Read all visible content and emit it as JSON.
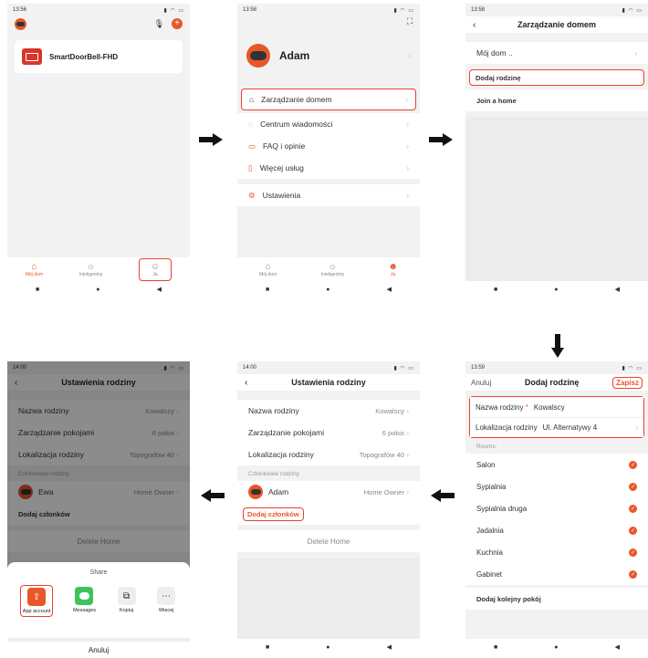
{
  "screen1": {
    "time": "13:56",
    "device_name": "SmartDoorBell-FHD",
    "tabs": [
      {
        "label": "Mój dom",
        "icon": "home-icon"
      },
      {
        "label": "Inteligentny",
        "icon": "sun-icon"
      },
      {
        "label": "Ja",
        "icon": "user-icon"
      }
    ]
  },
  "screen2": {
    "time": "13:58",
    "user_name": "Adam",
    "menu": [
      {
        "label": "Zarządzanie domem",
        "icon": "house-outline-icon"
      },
      {
        "label": "Centrum wiadomości",
        "icon": "chat-icon"
      },
      {
        "label": "FAQ i opinie",
        "icon": "faq-icon"
      },
      {
        "label": "Więcej usług",
        "icon": "bookmark-icon"
      },
      {
        "label": "Ustawienia",
        "icon": "settings-icon"
      }
    ],
    "tabs": [
      {
        "label": "Mój dom"
      },
      {
        "label": "Inteligentny"
      },
      {
        "label": "Ja"
      }
    ]
  },
  "screen3": {
    "time": "13:58",
    "title": "Zarządzanie domem",
    "my_home": "Mój dom ..",
    "add_family": "Dodaj rodzinę",
    "join_home": "Join a home"
  },
  "screen4": {
    "time": "13:59",
    "cancel": "Anuluj",
    "title": "Dodaj rodzinę",
    "save": "Zapisz",
    "family_name_label": "Nazwa rodziny",
    "required_mark": "*",
    "family_name_value": "Kowalscy",
    "location_label": "Lokalizacja rodziny",
    "location_value": "Ul. Alternatywy 4",
    "rooms_header": "Rooms:",
    "rooms": [
      "Salon",
      "Sypialnia",
      "Sypialnia druga",
      "Jadalnia",
      "Kuchnia",
      "Gabinet"
    ],
    "add_room": "Dodaj kolejny pokój"
  },
  "screen5": {
    "time": "14:00",
    "title": "Ustawienia rodziny",
    "family_name_label": "Nazwa rodziny",
    "family_name_value": "Kowalscy",
    "rooms_label": "Zarządzanie pokojami",
    "rooms_value": "6 pokoi",
    "location_label": "Lokalizacja rodziny",
    "location_value": "Topografów 40",
    "members_header": "Członkowie rodziny",
    "member_name": "Adam",
    "member_role": "Home Owner",
    "add_member": "Dodaj członków",
    "delete_home": "Delete Home"
  },
  "screen6": {
    "time": "14:00",
    "title": "Ustawienia rodziny",
    "family_name_label": "Nazwa rodziny",
    "family_name_value": "Kowalscy",
    "rooms_label": "Zarządzanie pokojami",
    "rooms_value": "6 pokoi",
    "location_label": "Lokalizacja rodziny",
    "location_value": "Topografów 40",
    "members_header": "Członkowie rodziny",
    "member_name": "Ewa",
    "member_role": "Home Owner",
    "add_member": "Dodaj członków",
    "delete_home": "Delete Home",
    "share_title": "Share",
    "share_options": [
      {
        "label": "App account",
        "icon": "app-account-icon"
      },
      {
        "label": "Messages",
        "icon": "messages-icon"
      },
      {
        "label": "Kopiuj",
        "icon": "copy-icon"
      },
      {
        "label": "Więcej",
        "icon": "more-icon"
      }
    ],
    "cancel": "Anuluj"
  },
  "colors": {
    "accent": "#e8572a",
    "highlight": "#e8412e",
    "device_icon": "#d8362a"
  }
}
